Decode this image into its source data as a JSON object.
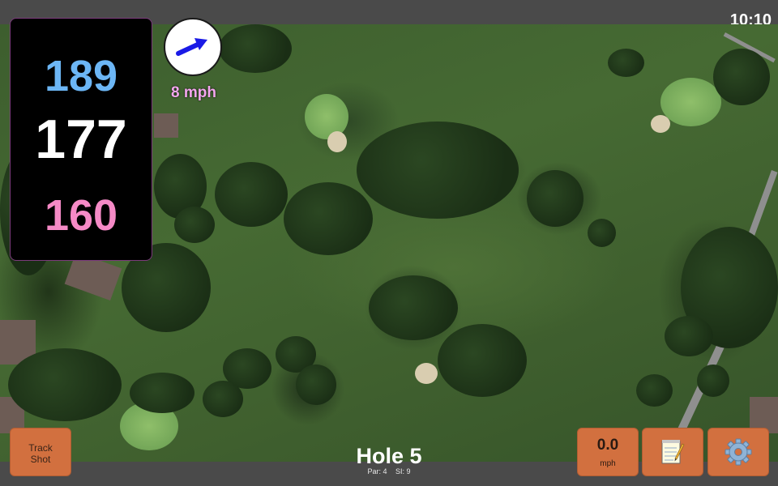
{
  "status_bar": {
    "time": "10:10"
  },
  "distances": {
    "back": "189",
    "middle": "177",
    "front": "160"
  },
  "wind": {
    "speed": "8 mph",
    "icon": "wind-arrow-icon",
    "arrow_color": "#1a1ae6"
  },
  "hole": {
    "title": "Hole 5",
    "par": "Par: 4",
    "stroke_index": "SI: 9"
  },
  "buttons": {
    "track_shot_line1": "Track",
    "track_shot_line2": "Shot",
    "speed_value": "0.0",
    "speed_unit": "mph",
    "notes_icon": "notepad-icon",
    "settings_icon": "gear-icon"
  },
  "colors": {
    "back_distance": "#6cb6f5",
    "middle_distance": "#ffffff",
    "front_distance": "#f58ac6",
    "button": "#d2703f"
  }
}
